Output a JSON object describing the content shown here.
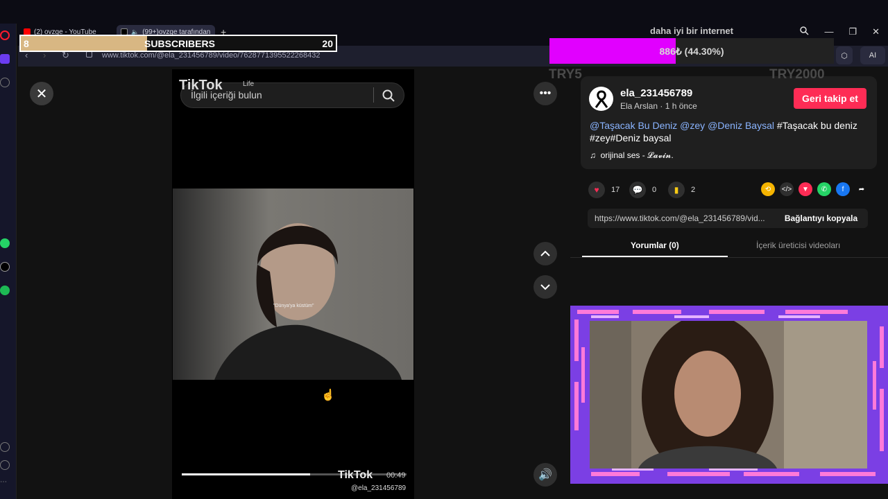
{
  "browser": {
    "tabs": [
      {
        "label": "(2) ovzge - YouTube",
        "active": false
      },
      {
        "label": "(99+)ovzge tarafından",
        "active": true
      }
    ],
    "url": "www.tiktok.com/@ela_231456789/video/7628771395522268432",
    "top_heading": "daha iyi bir internet",
    "ai_label": "AI"
  },
  "overlay": {
    "subs_current": "8",
    "subs_label": "SUBSCRIBERS",
    "subs_goal": "20",
    "subs_fraction": 0.4,
    "goal_text": "886₺ (44.30%)",
    "goal_fraction": 0.443,
    "goal_color": "#e100ff",
    "try_left": "TRY5",
    "try_right": "TRY2000"
  },
  "video": {
    "search_placeholder": "İlgili içeriği bulun",
    "logo": "TikTok",
    "logo_suffix": "Life",
    "frame_caption": "\"Dünya'ya küstüm\"",
    "watermark_logo": "TikTok",
    "watermark_time": "00:49",
    "watermark_user": "@ela_231456789",
    "progress_fraction": 0.57
  },
  "post": {
    "username": "ela_231456789",
    "display_name": "Ela Arslan",
    "time_ago": "1 h önce",
    "follow_label": "Geri takip et",
    "caption_mentions": [
      "@Taşacak Bu Deniz",
      "@zey",
      "@Deniz Baysal"
    ],
    "caption_tags_line1": "#Taşacak bu deniz",
    "caption_line2": "#zey#Deniz baysal",
    "music": "orijinal ses - 𝓛𝓪𝓿𝓲𝓷.",
    "likes": "17",
    "comments": "0",
    "saves": "2",
    "link_url": "https://www.tiktok.com/@ela_231456789/vid...",
    "copy_label": "Bağlantıyı kopyala",
    "tabs": [
      {
        "label": "Yorumlar (0)",
        "active": true
      },
      {
        "label": "İçerik üreticisi videoları",
        "active": false
      }
    ]
  },
  "colors": {
    "accent": "#fe2c55",
    "like": "#fe2c55",
    "save": "#facc15",
    "mention": "#8ab4ff",
    "cam_frame": "#7b3fe4"
  }
}
